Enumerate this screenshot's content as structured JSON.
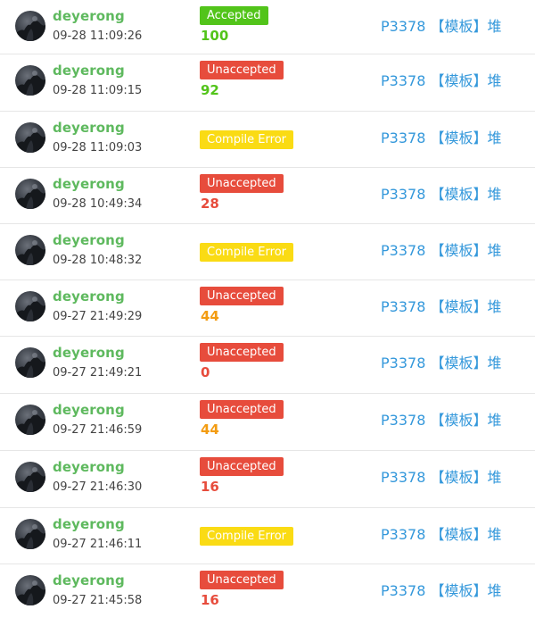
{
  "colors": {
    "username": "#5eb95e",
    "accepted": "#52c41a",
    "unaccepted": "#e74c3c",
    "compile_error": "#fadb14",
    "score_full": "#52c41a",
    "score_mid": "#f39c11",
    "score_low": "#e74c3c",
    "problem_link": "#3498db"
  },
  "records": [
    {
      "user": "deyerong",
      "time": "09-28 11:09:26",
      "status": "Accepted",
      "status_type": "ac",
      "score": "100",
      "score_color": "#52c41a",
      "problem": "P3378 【模板】堆"
    },
    {
      "user": "deyerong",
      "time": "09-28 11:09:15",
      "status": "Unaccepted",
      "status_type": "wa",
      "score": "92",
      "score_color": "#52c41a",
      "problem": "P3378 【模板】堆"
    },
    {
      "user": "deyerong",
      "time": "09-28 11:09:03",
      "status": "Compile Error",
      "status_type": "ce",
      "score": "",
      "score_color": "",
      "problem": "P3378 【模板】堆"
    },
    {
      "user": "deyerong",
      "time": "09-28 10:49:34",
      "status": "Unaccepted",
      "status_type": "wa",
      "score": "28",
      "score_color": "#e74c3c",
      "problem": "P3378 【模板】堆"
    },
    {
      "user": "deyerong",
      "time": "09-28 10:48:32",
      "status": "Compile Error",
      "status_type": "ce",
      "score": "",
      "score_color": "",
      "problem": "P3378 【模板】堆"
    },
    {
      "user": "deyerong",
      "time": "09-27 21:49:29",
      "status": "Unaccepted",
      "status_type": "wa",
      "score": "44",
      "score_color": "#f39c11",
      "problem": "P3378 【模板】堆"
    },
    {
      "user": "deyerong",
      "time": "09-27 21:49:21",
      "status": "Unaccepted",
      "status_type": "wa",
      "score": "0",
      "score_color": "#e74c3c",
      "problem": "P3378 【模板】堆"
    },
    {
      "user": "deyerong",
      "time": "09-27 21:46:59",
      "status": "Unaccepted",
      "status_type": "wa",
      "score": "44",
      "score_color": "#f39c11",
      "problem": "P3378 【模板】堆"
    },
    {
      "user": "deyerong",
      "time": "09-27 21:46:30",
      "status": "Unaccepted",
      "status_type": "wa",
      "score": "16",
      "score_color": "#e74c3c",
      "problem": "P3378 【模板】堆"
    },
    {
      "user": "deyerong",
      "time": "09-27 21:46:11",
      "status": "Compile Error",
      "status_type": "ce",
      "score": "",
      "score_color": "",
      "problem": "P3378 【模板】堆"
    },
    {
      "user": "deyerong",
      "time": "09-27 21:45:58",
      "status": "Unaccepted",
      "status_type": "wa",
      "score": "16",
      "score_color": "#e74c3c",
      "problem": "P3378 【模板】堆"
    }
  ]
}
